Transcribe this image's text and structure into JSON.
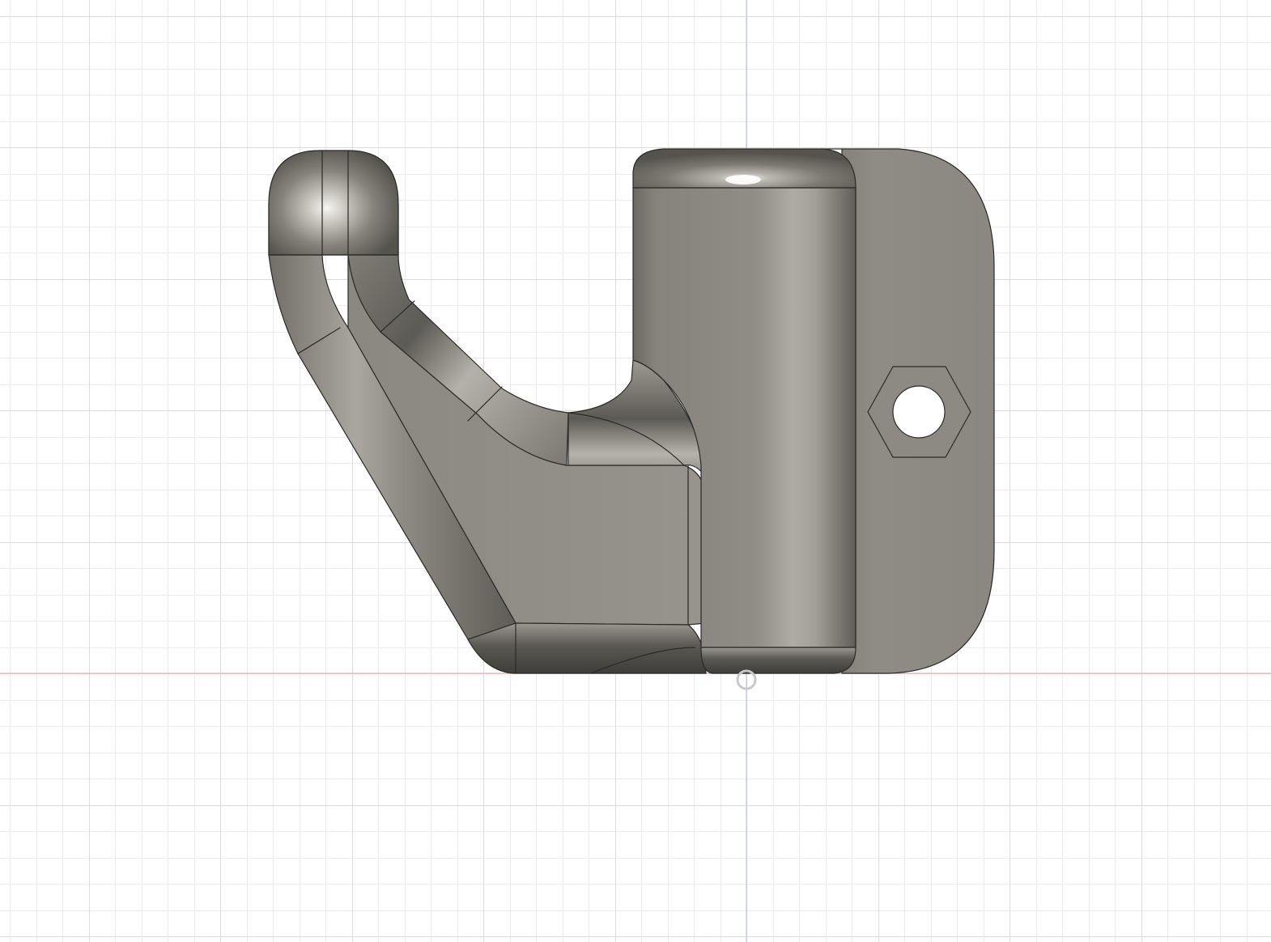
{
  "viewport": {
    "background": "#ffffff",
    "grid_minor_color": "#ececec",
    "grid_major_color": "#dcdcdc",
    "x_axis_color": "#f0a0a0",
    "y_axis_color": "#b6bde6"
  },
  "model": {
    "body_color": "#8e8c84",
    "edge_color": "#2a2a28",
    "highlight_color": "#c8c6be",
    "shadow_color": "#4e4c46"
  },
  "origin_marker": {
    "color": "#c8c8c8"
  }
}
